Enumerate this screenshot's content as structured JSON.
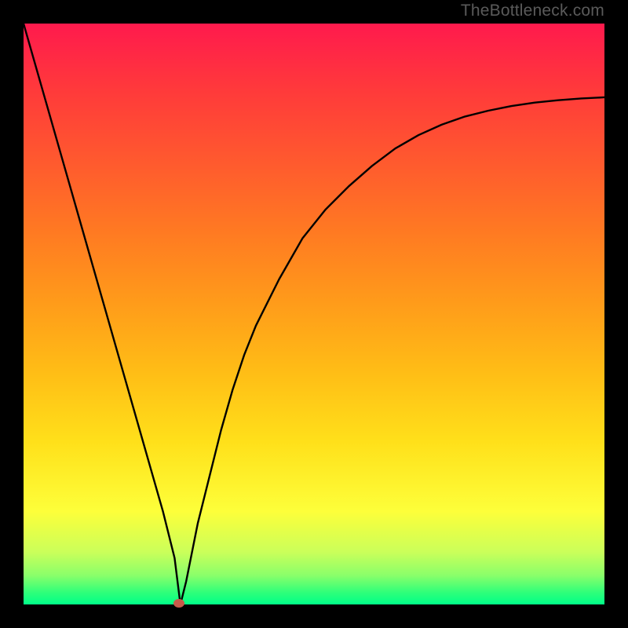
{
  "watermark": {
    "text": "TheBottleneck.com"
  },
  "chart_data": {
    "type": "line",
    "title": "",
    "xlabel": "",
    "ylabel": "",
    "xlim": [
      0,
      1
    ],
    "ylim": [
      0,
      1
    ],
    "series": [
      {
        "name": "bottleneck-curve",
        "x": [
          0.0,
          0.02,
          0.04,
          0.06,
          0.08,
          0.1,
          0.12,
          0.14,
          0.16,
          0.18,
          0.2,
          0.22,
          0.24,
          0.26,
          0.27,
          0.28,
          0.3,
          0.32,
          0.34,
          0.36,
          0.38,
          0.4,
          0.44,
          0.48,
          0.52,
          0.56,
          0.6,
          0.64,
          0.68,
          0.72,
          0.76,
          0.8,
          0.84,
          0.88,
          0.92,
          0.96,
          1.0
        ],
        "y": [
          1.0,
          0.93,
          0.86,
          0.79,
          0.72,
          0.65,
          0.58,
          0.51,
          0.44,
          0.37,
          0.3,
          0.23,
          0.16,
          0.08,
          0.0,
          0.04,
          0.14,
          0.22,
          0.3,
          0.37,
          0.43,
          0.48,
          0.56,
          0.63,
          0.68,
          0.72,
          0.755,
          0.785,
          0.808,
          0.826,
          0.84,
          0.85,
          0.858,
          0.864,
          0.868,
          0.871,
          0.873
        ]
      }
    ],
    "marker": {
      "x": 0.268,
      "y": 0.003
    },
    "gradient_stops": [
      {
        "pos": 0.0,
        "color": "#ff1a4d"
      },
      {
        "pos": 0.12,
        "color": "#ff3b3a"
      },
      {
        "pos": 0.24,
        "color": "#ff5a2e"
      },
      {
        "pos": 0.36,
        "color": "#ff7a22"
      },
      {
        "pos": 0.48,
        "color": "#ff9b1a"
      },
      {
        "pos": 0.6,
        "color": "#ffbd16"
      },
      {
        "pos": 0.72,
        "color": "#ffe01a"
      },
      {
        "pos": 0.84,
        "color": "#fdff3a"
      },
      {
        "pos": 0.91,
        "color": "#caff5a"
      },
      {
        "pos": 0.95,
        "color": "#8aff6a"
      },
      {
        "pos": 0.98,
        "color": "#2dff7a"
      },
      {
        "pos": 1.0,
        "color": "#00ff88"
      }
    ]
  }
}
